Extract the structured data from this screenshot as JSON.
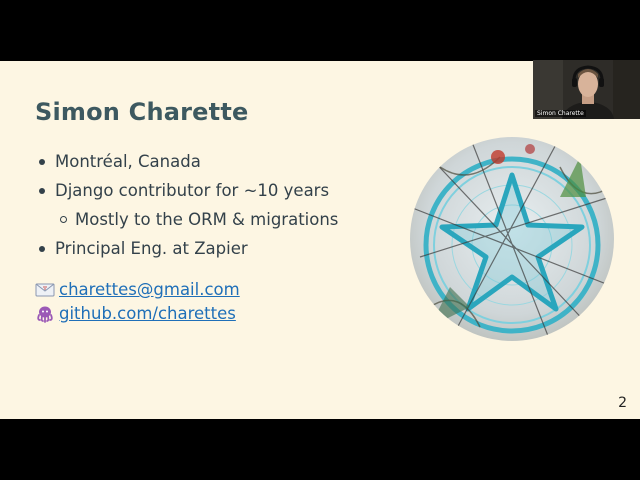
{
  "slide": {
    "title": "Simon Charette",
    "bullets": [
      {
        "text": "Montréal, Canada",
        "level": 1
      },
      {
        "text": "Django contributor for ~10 years",
        "level": 1
      },
      {
        "text": "Mostly to the ORM & migrations",
        "level": 2
      },
      {
        "text": "Principal Eng. at Zapier",
        "level": 1
      }
    ],
    "links": [
      {
        "icon": "envelope-icon",
        "text": "charettes@gmail.com"
      },
      {
        "icon": "octopus-icon",
        "text": "github.com/charettes"
      }
    ],
    "page_number": "2",
    "photo_icon": "circular-photo"
  },
  "video": {
    "participant_name": "Simon Charette"
  },
  "colors": {
    "title": "#3d5960",
    "background": "#fdf6e3",
    "link": "#1f6fb8"
  }
}
